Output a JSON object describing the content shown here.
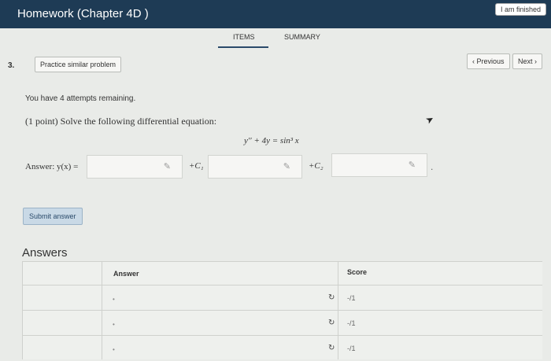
{
  "header": {
    "title": "Homework (Chapter 4D )",
    "finished_label": "I am finished"
  },
  "tabs": {
    "items": "ITEMS",
    "summary": "SUMMARY"
  },
  "question": {
    "number": "3.",
    "practice_label": "Practice similar problem",
    "prev_label": "‹ Previous",
    "next_label": "Next ›",
    "attempts": "You have 4 attempts remaining.",
    "prompt": "(1 point) Solve the following differential equation:",
    "equation": "y′′ + 4y = sin³ x",
    "answer_label": "Answer: y(x) =",
    "const1": "+C₁",
    "const2": "+C₂",
    "trailing_dot": ".",
    "submit_label": "Submit answer"
  },
  "answers": {
    "title": "Answers",
    "col_answer": "Answer",
    "col_score": "Score",
    "rows": [
      {
        "bullet": "•",
        "score": "-/1"
      },
      {
        "bullet": "•",
        "score": "-/1"
      },
      {
        "bullet": "•",
        "score": "-/1"
      }
    ]
  }
}
